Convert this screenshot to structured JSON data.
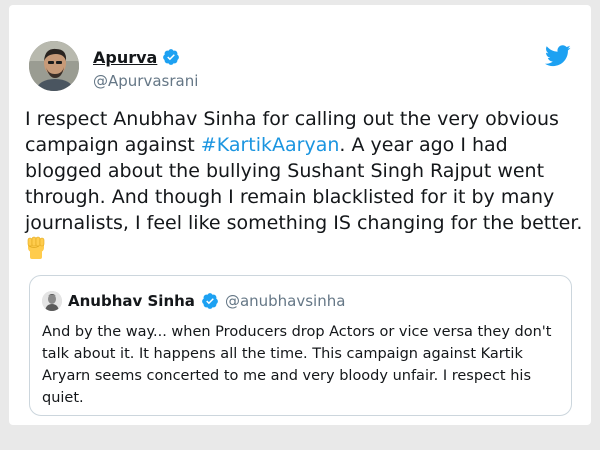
{
  "tweet": {
    "author_name": "Apurva",
    "author_handle": "@Apurvasrani",
    "text_before_hashtag": "I respect Anubhav Sinha for calling out the very obvious campaign against ",
    "hashtag": "#KartikAaryan",
    "text_after_hashtag": ". A year ago I had blogged about the bullying Sushant Singh Rajput went through. And though I remain blacklisted for it by many journalists, I feel like something IS changing for the better.",
    "emoji_icon": "raised-fist-emoji"
  },
  "quoted_tweet": {
    "author_name": "Anubhav Sinha",
    "author_handle": "@anubhavsinha",
    "text": "And by the way... when Producers drop Actors or vice versa they don't talk about it. It happens all the time. This campaign against Kartik Aryarn seems concerted to me and very bloody unfair. I respect his quiet."
  },
  "icons": {
    "brand": "twitter-bird-icon",
    "verified": "verified-badge-icon"
  },
  "colors": {
    "brand_blue": "#1da1f2",
    "hashtag_blue": "#1b95e0",
    "text": "#14171a",
    "muted": "#657786",
    "border": "#ccd6dd",
    "background": "#e9e9e9"
  }
}
